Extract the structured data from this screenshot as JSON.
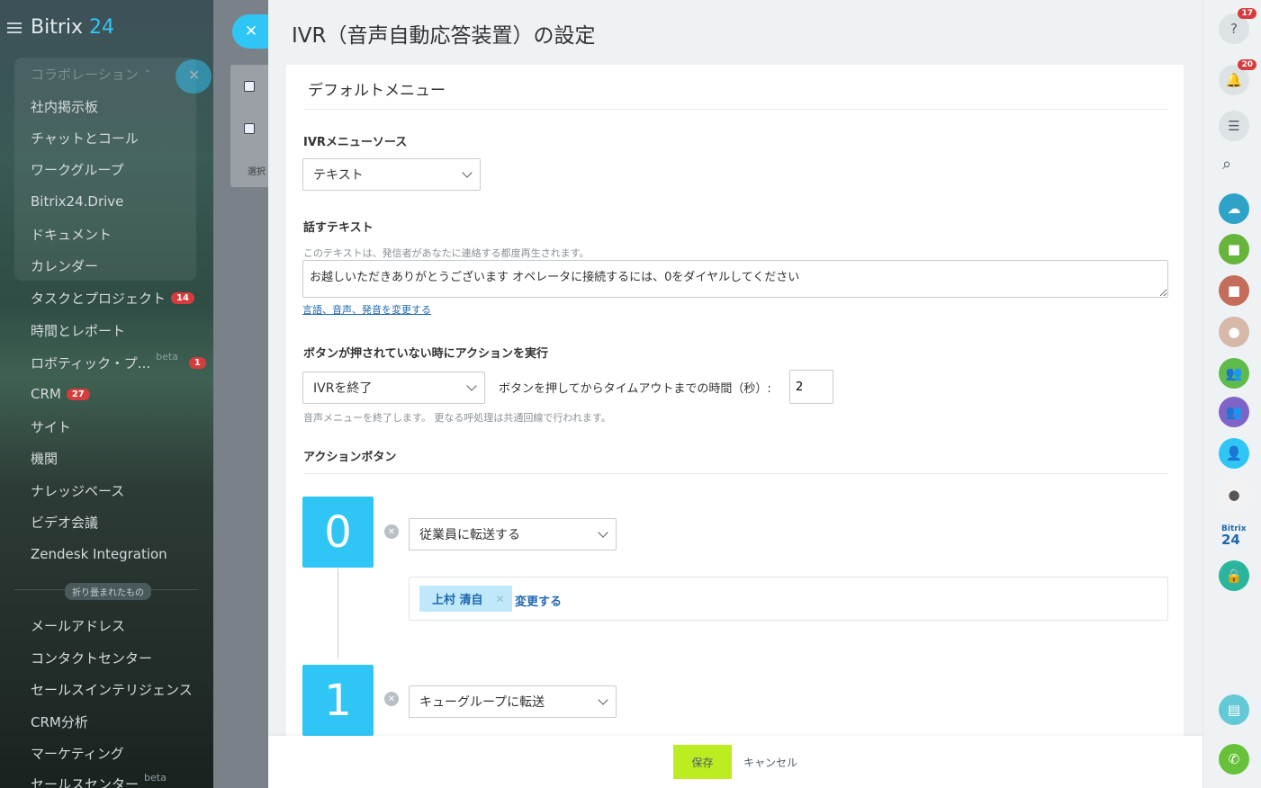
{
  "sidebar": {
    "logo_brand": "Bitrix",
    "logo_num": "24",
    "group_title": "コラボレーション",
    "items": [
      {
        "label": "社内掲示板"
      },
      {
        "label": "チャットとコール"
      },
      {
        "label": "ワークグループ"
      },
      {
        "label": "Bitrix24.Drive"
      },
      {
        "label": "ドキュメント"
      },
      {
        "label": "カレンダー"
      },
      {
        "label": "タスクとプロジェクト",
        "badge": "14"
      },
      {
        "label": "時間とレポート"
      },
      {
        "label": "ロボティック・プ...",
        "beta": "beta",
        "badge": "1"
      },
      {
        "label": "CRM",
        "badge": "27"
      },
      {
        "label": "サイト"
      },
      {
        "label": "機関"
      },
      {
        "label": "ナレッジベース"
      },
      {
        "label": "ビデオ会議"
      },
      {
        "label": "Zendesk Integration"
      }
    ],
    "collapsed_label": "折り畳まれたもの",
    "collapsed_items": [
      {
        "label": "メールアドレス"
      },
      {
        "label": "コンタクトセンター"
      },
      {
        "label": "セールスインテリジェンス"
      },
      {
        "label": "CRM分析"
      },
      {
        "label": "マーケティング"
      },
      {
        "label": "セールスセンター",
        "beta": "beta"
      }
    ]
  },
  "background": {
    "select_text": "選択"
  },
  "panel": {
    "title": "IVR（音声自動応答装置）の設定",
    "section_title": "デフォルトメニュー",
    "source_label": "IVRメニューソース",
    "source_value": "テキスト",
    "speech_label": "話すテキスト",
    "speech_hint": "このテキストは、発信者があなたに連絡する都度再生されます。",
    "speech_text": "お越しいただきありがとうございます オペレータに接続するには、0をダイヤルしてください",
    "voice_link": "言語、音声、発音を変更する",
    "no_press_label": "ボタンが押されていない時にアクションを実行",
    "no_press_action": "IVRを終了",
    "timeout_label": "ボタンを押してからタイムアウトまでの時間（秒）:",
    "timeout_value": "2",
    "no_press_hint": "音声メニューを終了します。 更なる呼処理は共通回線で行われます。",
    "action_buttons_label": "アクションボタン",
    "actions": [
      {
        "digit": "0",
        "action": "従業員に転送する",
        "employee": "上村 清自",
        "change_link": "変更する"
      },
      {
        "digit": "1",
        "action": "キューグループに転送"
      }
    ],
    "save_label": "保存",
    "cancel_label": "キャンセル"
  },
  "rightbar": {
    "help_badge": "17",
    "notify_badge": "20",
    "logo_small": "Bitrix",
    "logo_big": "24"
  },
  "colors": {
    "accent": "#2fc6f6",
    "save": "#bbed21",
    "badge": "#d73c3c",
    "link": "#2067b0"
  }
}
